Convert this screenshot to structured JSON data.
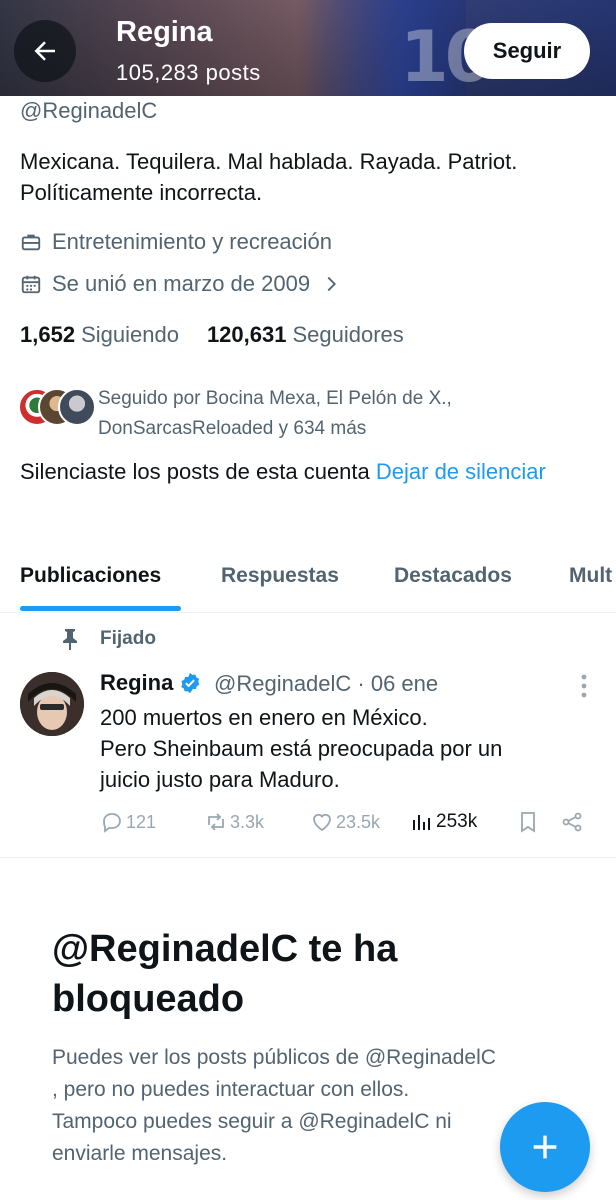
{
  "header": {
    "name": "Regina",
    "posts_count": "105,283 posts",
    "follow_label": "Seguir",
    "banner_number": "10"
  },
  "profile": {
    "handle": "@ReginadelC",
    "bio_line1": "Mexicana. Tequilera. Mal hablada. Rayada. Patriot.",
    "bio_line2": "Políticamente incorrecta.",
    "category": "Entretenimiento y recreación",
    "joined": "Se unió en marzo de 2009",
    "following_count": "1,652",
    "following_label": "Siguiendo",
    "followers_count": "120,631",
    "followers_label": "Seguidores",
    "followed_by_line1": "Seguido por Bocina Mexa, El Pelón de X.,",
    "followed_by_line2": "DonSarcasReloaded y 634 más",
    "muted_text": "Silenciaste los posts de esta cuenta ",
    "unmute_link": "Dejar de silenciar"
  },
  "tabs": [
    {
      "label": "Publicaciones",
      "active": true
    },
    {
      "label": "Respuestas",
      "active": false
    },
    {
      "label": "Destacados",
      "active": false
    },
    {
      "label": "Mult",
      "active": false
    }
  ],
  "pinned_tweet": {
    "pinned_label": "Fijado",
    "author_name": "Regina",
    "author_handle": "@ReginadelC · 06 ene",
    "text_line1": "200 muertos en enero en México.",
    "text_line2": "Pero Sheinbaum está preocupada por un",
    "text_line3": "juicio justo para Maduro.",
    "replies": "121",
    "reposts": "3.3k",
    "likes": "23.5k",
    "views": "253k"
  },
  "blocked": {
    "title_line1": "@ReginadelC te ha",
    "title_line2": "bloqueado",
    "desc_line1": "Puedes ver los posts públicos de @ReginadelC",
    "desc_line2": ", pero no puedes interactuar con ellos.",
    "desc_line3": "Tampoco puedes seguir a @ReginadelC ni",
    "desc_line4": "enviarle mensajes."
  },
  "colors": {
    "accent": "#1d9bf0",
    "text_primary": "#0f1419",
    "text_secondary": "#536471"
  }
}
